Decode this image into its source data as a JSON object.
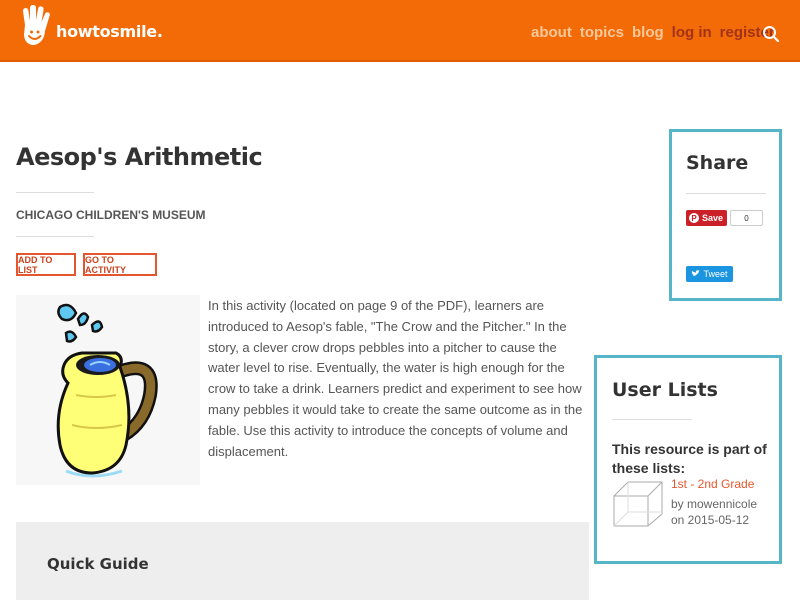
{
  "brand": {
    "name": "howtosmile."
  },
  "nav": {
    "items": [
      {
        "label": "about",
        "tone": "light"
      },
      {
        "label": "topics",
        "tone": "light"
      },
      {
        "label": "blog",
        "tone": "light"
      },
      {
        "label": "log in",
        "tone": "dark"
      },
      {
        "label": "register",
        "tone": "dark"
      }
    ],
    "search_icon": "search-icon"
  },
  "resource": {
    "title": "Aesop's Arithmetic",
    "publisher": "CHICAGO CHILDREN'S MUSEUM",
    "add_to_list": "ADD TO LIST",
    "go_to_activity": "GO TO ACTIVITY",
    "description": "In this activity (located on page 9 of the PDF), learners are introduced to Aesop's fable, \"The Crow and the Pitcher.\" In the story, a clever crow drops pebbles into a pitcher to cause the water level to rise. Eventually, the water is high enough for the crow to take a drink. Learners predict and experiment to see how many pebbles it would take to create the same outcome as in the fable. Use this activity to introduce the concepts of volume and displacement."
  },
  "quick_guide": {
    "title": "Quick Guide"
  },
  "share": {
    "title": "Share",
    "pin_label": "Save",
    "pin_count": "0",
    "tweet_label": "Tweet"
  },
  "user_lists": {
    "title": "User Lists",
    "part_of": "This resource is part of these lists:",
    "items": [
      {
        "name": "1st - 2nd Grade",
        "by": "by mowennicole",
        "on": "on 2015-05-12"
      }
    ]
  },
  "colors": {
    "header": "#f26b07",
    "accent": "#e4572e",
    "box_border": "#56b5c7"
  }
}
